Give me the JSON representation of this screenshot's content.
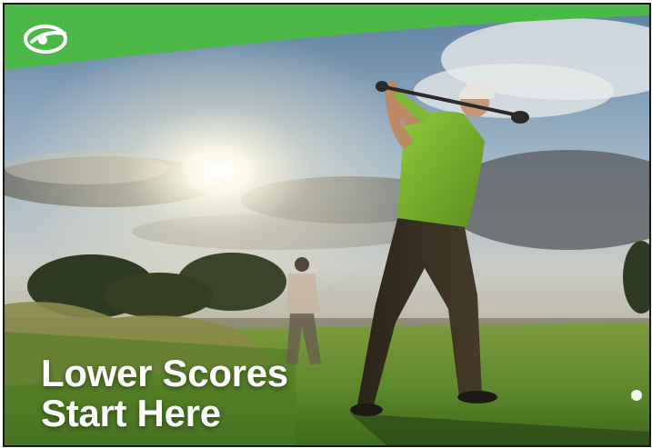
{
  "banner": {
    "brand_color": "#4cb848",
    "logo_icon": "golf-ball-swoosh-logo",
    "headline_line1": "Lower Scores",
    "headline_line2": "Start Here",
    "photo_subject": "golfer-swinging-at-sunset"
  }
}
